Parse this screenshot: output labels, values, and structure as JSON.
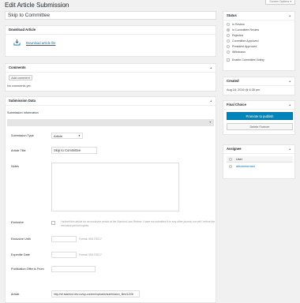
{
  "page": {
    "title": "Edit Article Submission",
    "screen_options": "Screen Options ▾"
  },
  "title_field": {
    "value": "Skip to Committee"
  },
  "download_box": {
    "heading": "Download Article",
    "link": "Download article file"
  },
  "comments_box": {
    "heading": "Comments",
    "add_button": "Add comment",
    "empty": "No comments yet."
  },
  "submission_box": {
    "heading": "Submission Data",
    "info_heading": "Submission Information",
    "type_label": "Submission Type",
    "type_value": "Article",
    "title_label": "Article Title",
    "title_value": "Skip to Committee",
    "notes_label": "Notes",
    "exclusive_label": "Exclusive",
    "exclusive_text": "I submit this article for an exclusive period at the Stanford Law Review. I have not submitted it to any other journal, nor will I before the exclusive period expires.",
    "exclusive_until_label": "Exclusive Until",
    "date_hint": "Format: 05/17/2017",
    "expedite_label": "Expedite Date",
    "pub_offer_label": "Publication Offer is From",
    "article_label": "Article",
    "article_url": "http://slr.stanford.dev.cc/wp-content/uploads/submission_files/1205/"
  },
  "status_box": {
    "heading": "Status",
    "options": [
      "In Review",
      "In Committee Review",
      "Rejected",
      "Committee Approved",
      "President Approved",
      "Withdrawn"
    ],
    "selected": "In Committee Review",
    "enable_voting": "Enable Committee Voting"
  },
  "created_box": {
    "heading": "Created",
    "value": "Aug 16, 2016 @ 6:35 pm"
  },
  "final_box": {
    "heading": "Final Choice",
    "publish": "Promote to publish",
    "delete": "Delete Forever"
  },
  "assignee_box": {
    "heading": "Assignee",
    "col_header": "User",
    "user": "articlemember"
  },
  "colors": {
    "primary_button": "#0085ba",
    "link": "#0073aa",
    "background": "#f1f1f1"
  }
}
